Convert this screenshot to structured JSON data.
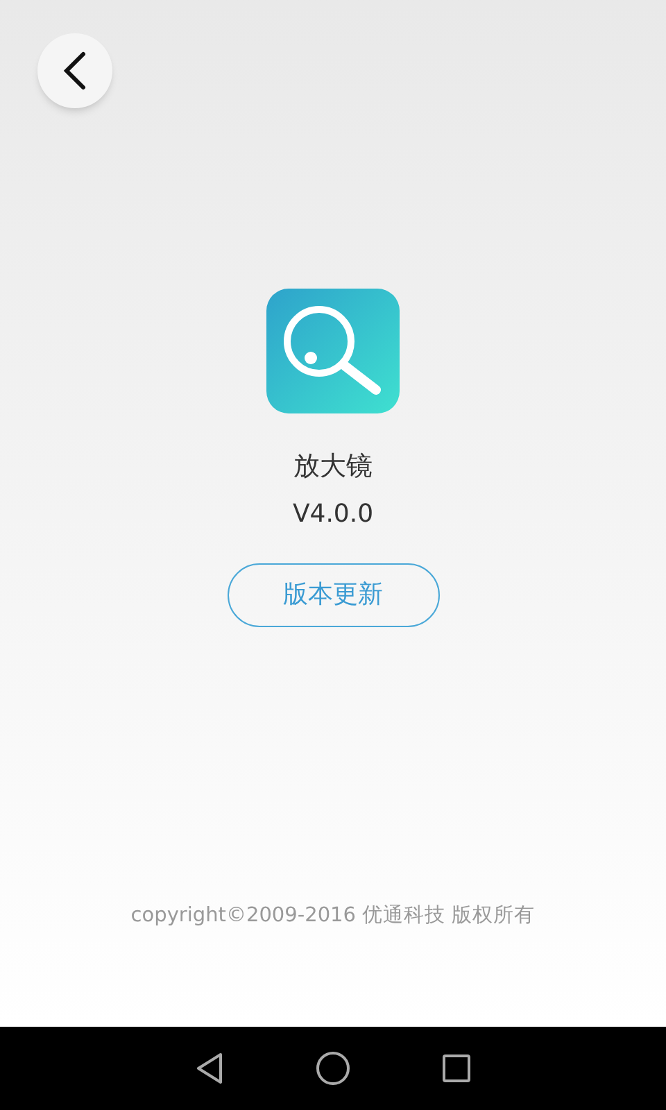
{
  "app": {
    "name": "放大镜",
    "version": "V4.0.0"
  },
  "update_button": {
    "label": "版本更新"
  },
  "footer": {
    "copyright": "copyright©2009-2016 优通科技 版权所有"
  },
  "nav_bar": {
    "buttons": [
      {
        "kind": "back"
      },
      {
        "kind": "home"
      },
      {
        "kind": "recents"
      }
    ]
  }
}
